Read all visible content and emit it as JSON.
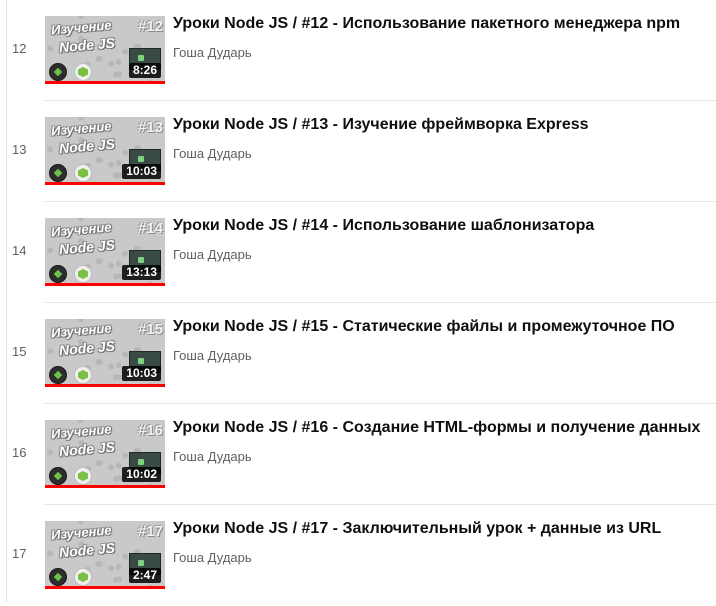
{
  "playlist": {
    "items": [
      {
        "index": "12",
        "thumb_label": "Изучение",
        "thumb_label2": "Node JS",
        "thumb_number": "#12",
        "duration": "8:26",
        "watched": 1.0,
        "title": "Уроки Node JS / #12 - Использование пакетного менеджера npm",
        "channel": "Гоша Дударь"
      },
      {
        "index": "13",
        "thumb_label": "Изучение",
        "thumb_label2": "Node JS",
        "thumb_number": "#13",
        "duration": "10:03",
        "watched": 1.0,
        "title": "Уроки Node JS / #13 - Изучение фреймворка Express",
        "channel": "Гоша Дударь"
      },
      {
        "index": "14",
        "thumb_label": "Изучение",
        "thumb_label2": "Node JS",
        "thumb_number": "#14",
        "duration": "13:13",
        "watched": 1.0,
        "title": "Уроки Node JS / #14 - Использование шаблонизатора",
        "channel": "Гоша Дударь"
      },
      {
        "index": "15",
        "thumb_label": "Изучение",
        "thumb_label2": "Node JS",
        "thumb_number": "#15",
        "duration": "10:03",
        "watched": 1.0,
        "title": "Уроки Node JS / #15 - Статические файлы и промежуточное ПО",
        "channel": "Гоша Дударь"
      },
      {
        "index": "16",
        "thumb_label": "Изучение",
        "thumb_label2": "Node JS",
        "thumb_number": "#16",
        "duration": "10:02",
        "watched": 1.0,
        "title": "Уроки Node JS / #16 - Создание HTML-формы и получение данных",
        "channel": "Гоша Дударь"
      },
      {
        "index": "17",
        "thumb_label": "Изучение",
        "thumb_label2": "Node JS",
        "thumb_number": "#17",
        "duration": "2:47",
        "watched": 1.0,
        "title": "Уроки Node JS / #17 - Заключительный урок + данные из URL",
        "channel": "Гоша Дударь"
      }
    ]
  },
  "colors": {
    "progress": "#ff0000",
    "title": "#0f0f0f",
    "secondary_text": "#606060"
  }
}
